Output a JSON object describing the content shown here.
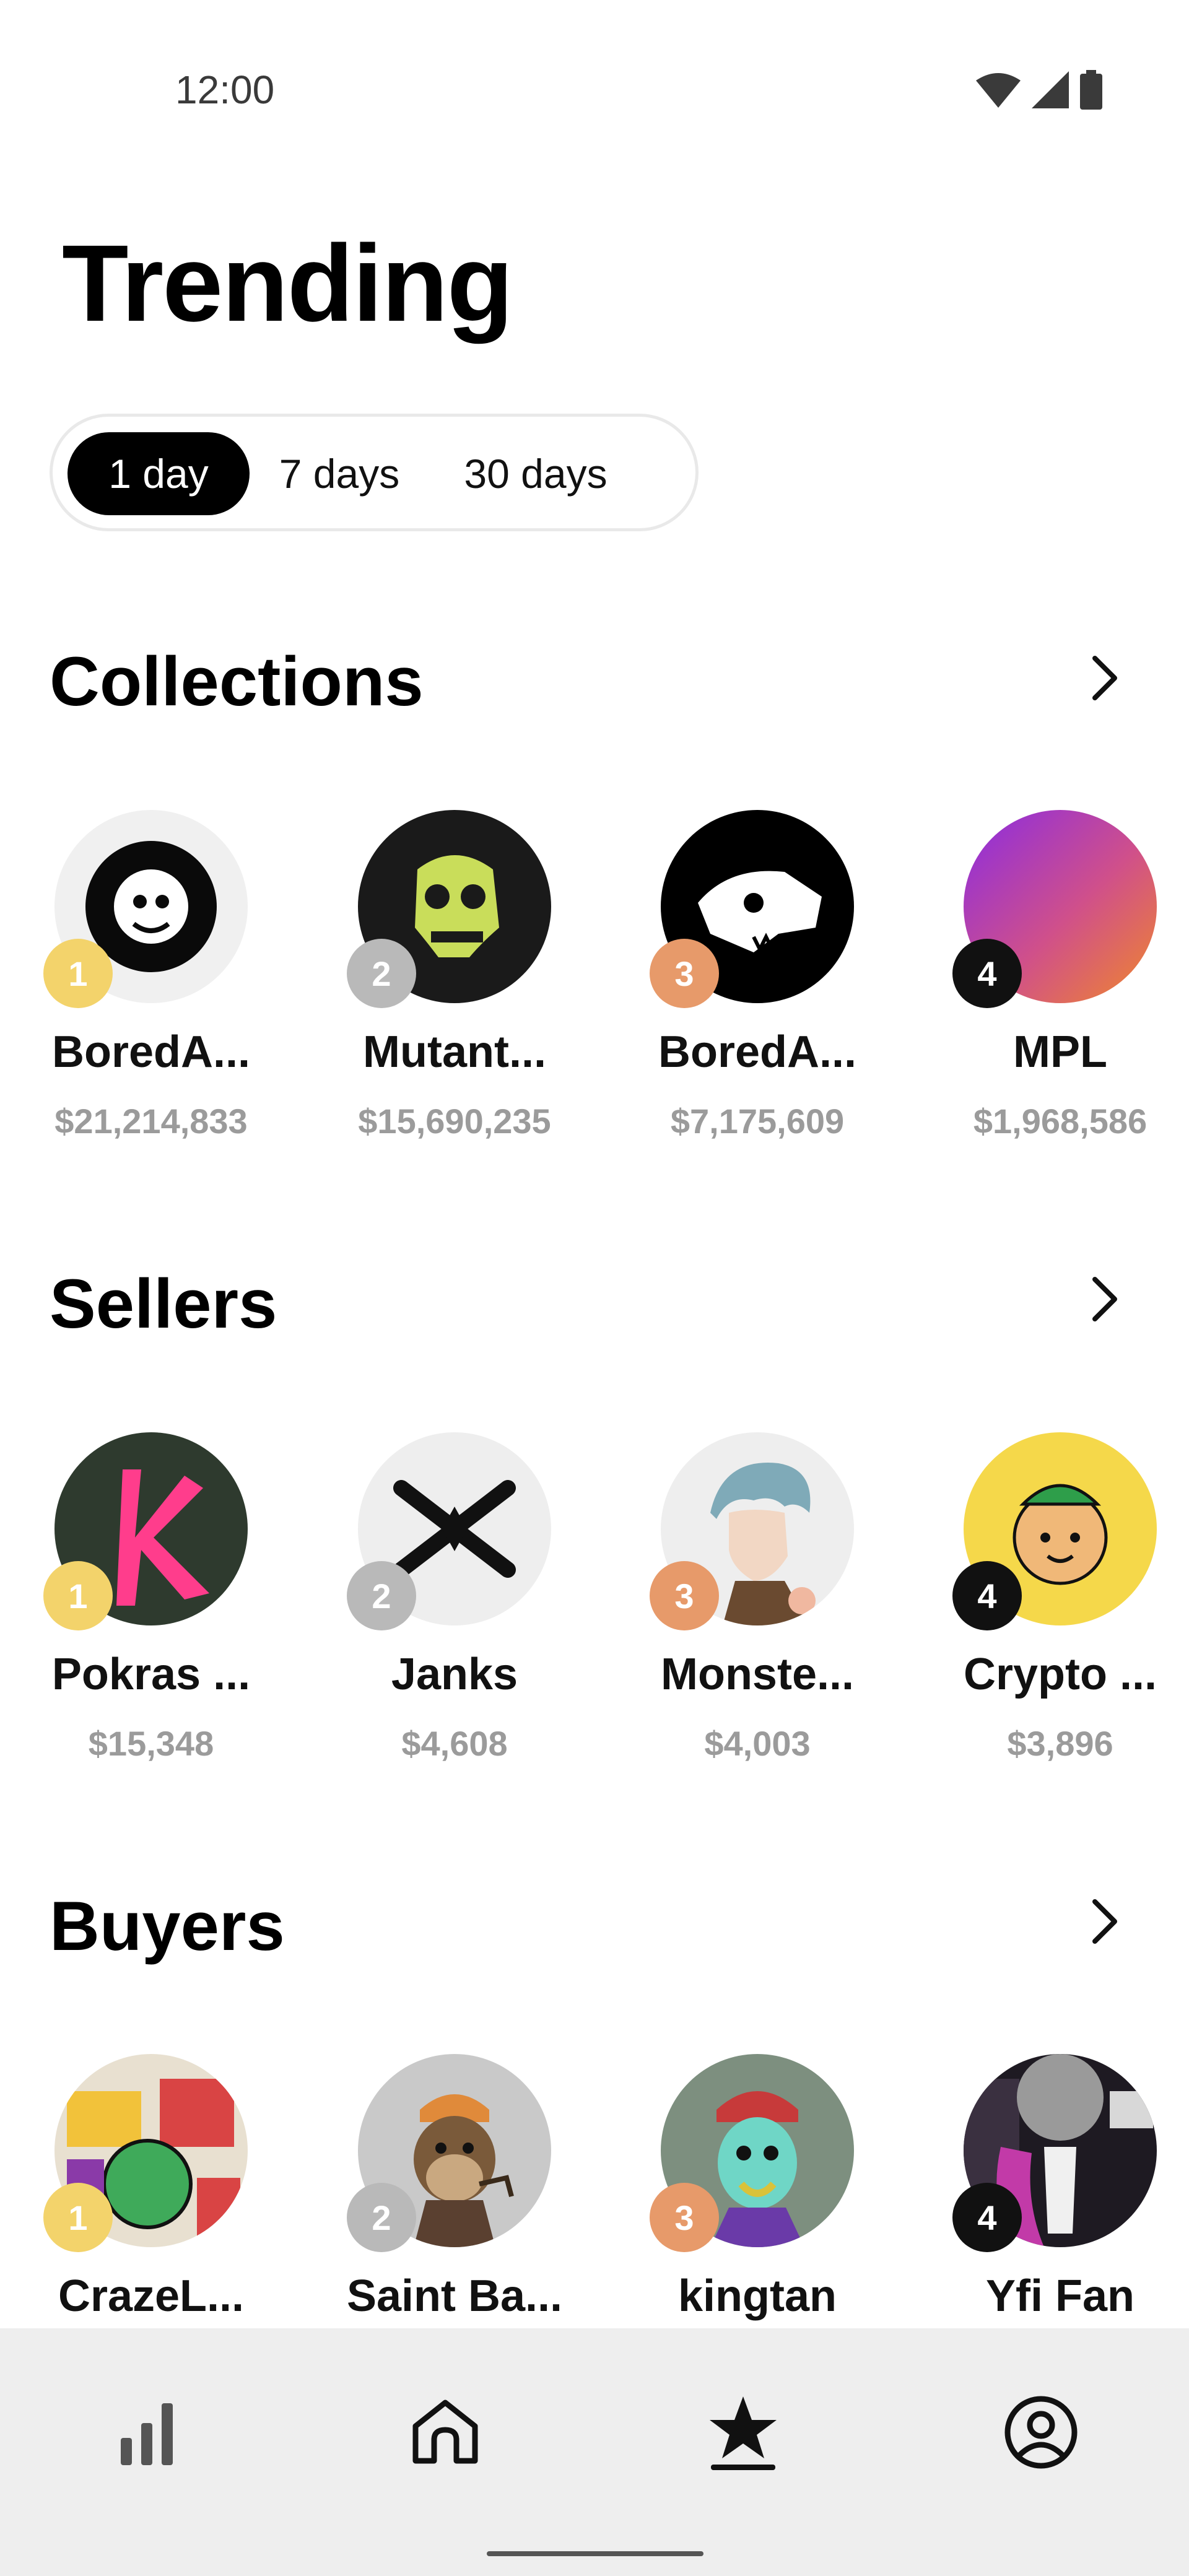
{
  "status_bar": {
    "time": "12:00"
  },
  "title": "Trending",
  "periods": [
    "1 day",
    "7 days",
    "30 days"
  ],
  "selected_period": "1 day",
  "collections": {
    "title": "Collections",
    "items": [
      {
        "rank": "1",
        "name": "BoredA...",
        "value": "$21,214,833"
      },
      {
        "rank": "2",
        "name": "Mutant...",
        "value": "$15,690,235"
      },
      {
        "rank": "3",
        "name": "BoredA...",
        "value": "$7,175,609"
      },
      {
        "rank": "4",
        "name": "MPL",
        "value": "$1,968,586"
      }
    ]
  },
  "sellers": {
    "title": "Sellers",
    "items": [
      {
        "rank": "1",
        "name": "Pokras ...",
        "value": "$15,348"
      },
      {
        "rank": "2",
        "name": "Janks",
        "value": "$4,608"
      },
      {
        "rank": "3",
        "name": "Monste...",
        "value": "$4,003"
      },
      {
        "rank": "4",
        "name": "Crypto ...",
        "value": "$3,896"
      }
    ]
  },
  "buyers": {
    "title": "Buyers",
    "items": [
      {
        "rank": "1",
        "name": "CrazeL..."
      },
      {
        "rank": "2",
        "name": "Saint Ba..."
      },
      {
        "rank": "3",
        "name": "kingtan"
      },
      {
        "rank": "4",
        "name": "Yfi Fan"
      }
    ]
  },
  "nav": {
    "items": [
      "stats-icon",
      "home-icon",
      "star-icon",
      "profile-icon"
    ],
    "active": "star-icon"
  },
  "colors": {
    "badge_1": "#f3d36b",
    "badge_2": "#b9b9b9",
    "badge_3": "#e79a6a",
    "badge_4": "#111111",
    "selected_segment": "#000000",
    "value_text": "#9b9b9b",
    "nav_background": "#eeeeee"
  }
}
